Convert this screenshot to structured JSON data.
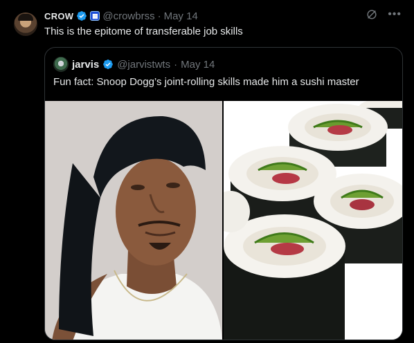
{
  "tweet": {
    "author_name": "CROW",
    "handle": "@crowbrss",
    "separator": "·",
    "date": "May 14",
    "text": "This is the epitome of transferable job skills"
  },
  "quoted": {
    "author_name": "jarvis",
    "handle": "@jarvistwts",
    "separator": "·",
    "date": "May 14",
    "text": "Fun fact: Snoop Dogg’s joint-rolling skills made him a sushi master"
  },
  "icons": {
    "verified": "verified-check-icon",
    "affiliate": "affiliate-badge-icon",
    "grok": "grok-icon",
    "more": "more-icon"
  },
  "colors": {
    "background": "#000000",
    "text": "#e7e9ea",
    "muted": "#71767b",
    "verified_blue": "#1d9bf0",
    "border": "#2f3336"
  }
}
